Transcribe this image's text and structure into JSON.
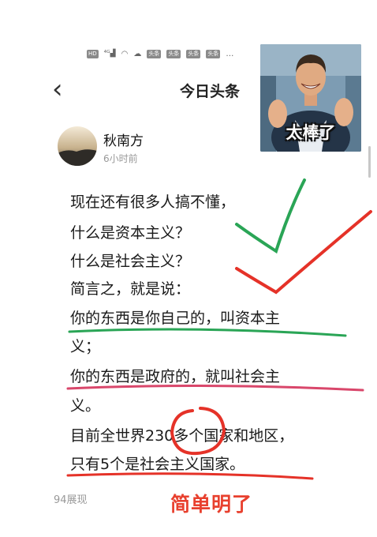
{
  "nav": {
    "back_glyph": "‹",
    "title": "今日头条"
  },
  "status_bar": {
    "icons": [
      "HD",
      "4G",
      "signal-icon",
      "wifi-icon",
      "cloud-icon",
      "头条",
      "头条",
      "头条",
      "头条",
      "…",
      "eye-icon"
    ]
  },
  "author": {
    "name": "秋南方",
    "time": "6小时前"
  },
  "post": {
    "lines": [
      "现在还有很多人搞不懂，",
      "什么是资本主义？",
      "什么是社会主义？",
      "简言之，就是说：",
      "你的东西是你自己的，叫资本主",
      "义；",
      "你的东西是政府的，就叫社会主",
      "义。",
      "目前全世界230多个国家和地区，",
      "只有5个是社会主义国家。"
    ]
  },
  "footer": {
    "views": "94展现"
  },
  "meme": {
    "caption": "太棒了"
  },
  "annotations": {
    "stamp": "简单明了",
    "colors": {
      "red": "#e53228",
      "green": "#2aa556",
      "pink": "#d9476b"
    }
  }
}
